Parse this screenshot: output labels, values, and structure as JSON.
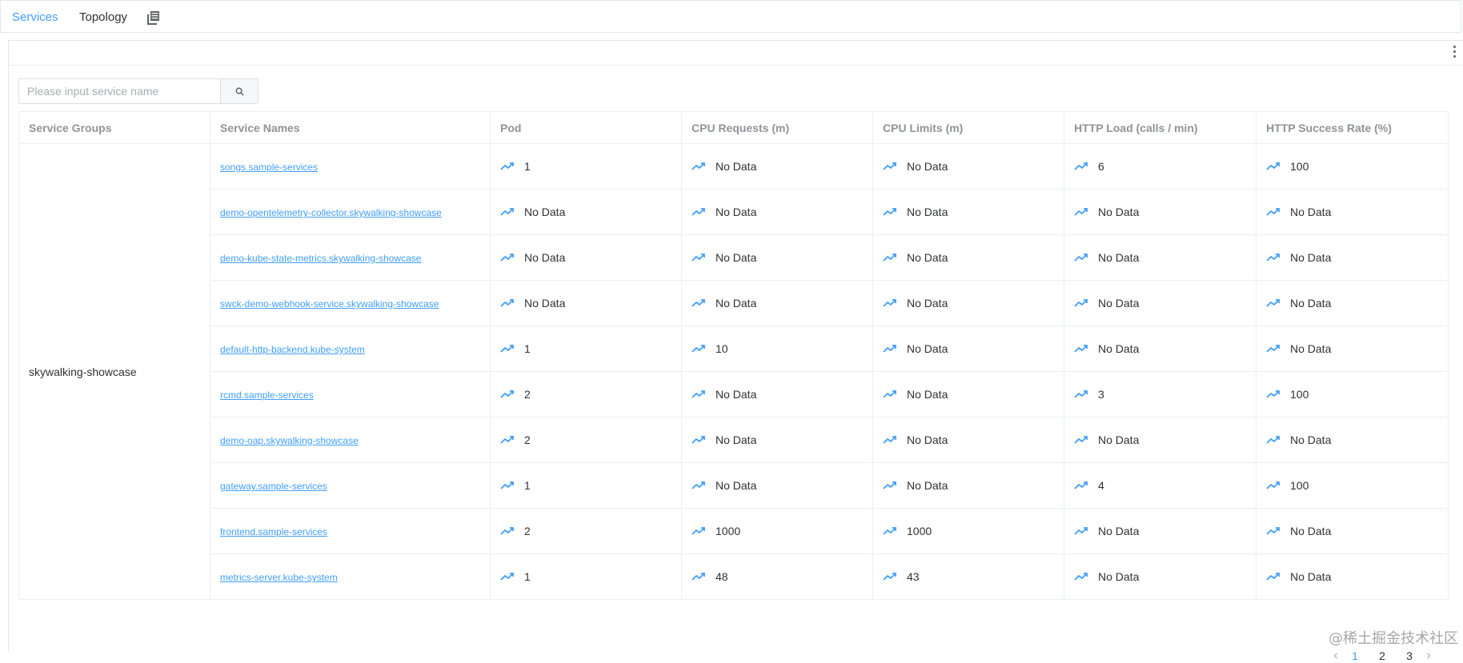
{
  "tabs": {
    "services": "Services",
    "topology": "Topology"
  },
  "search": {
    "placeholder": "Please input service name"
  },
  "table": {
    "headers": {
      "service_groups": "Service Groups",
      "service_names": "Service Names",
      "pod": "Pod",
      "cpu_requests": "CPU Requests (m)",
      "cpu_limits": "CPU Limits (m)",
      "http_load": "HTTP Load (calls / min)",
      "http_success": "HTTP Success Rate (%)"
    },
    "group": "skywalking-showcase",
    "rows": [
      {
        "name": "songs.sample-services",
        "pod": "1",
        "cpu_req": "No Data",
        "cpu_lim": "No Data",
        "load": "6",
        "success": "100"
      },
      {
        "name": "demo-opentelemetry-collector.skywalking-showcase",
        "pod": "No Data",
        "cpu_req": "No Data",
        "cpu_lim": "No Data",
        "load": "No Data",
        "success": "No Data"
      },
      {
        "name": "demo-kube-state-metrics.skywalking-showcase",
        "pod": "No Data",
        "cpu_req": "No Data",
        "cpu_lim": "No Data",
        "load": "No Data",
        "success": "No Data"
      },
      {
        "name": "swck-demo-webhook-service.skywalking-showcase",
        "pod": "No Data",
        "cpu_req": "No Data",
        "cpu_lim": "No Data",
        "load": "No Data",
        "success": "No Data"
      },
      {
        "name": "default-http-backend.kube-system",
        "pod": "1",
        "cpu_req": "10",
        "cpu_lim": "No Data",
        "load": "No Data",
        "success": "No Data"
      },
      {
        "name": "rcmd.sample-services",
        "pod": "2",
        "cpu_req": "No Data",
        "cpu_lim": "No Data",
        "load": "3",
        "success": "100"
      },
      {
        "name": "demo-oap.skywalking-showcase",
        "pod": "2",
        "cpu_req": "No Data",
        "cpu_lim": "No Data",
        "load": "No Data",
        "success": "No Data"
      },
      {
        "name": "gateway.sample-services",
        "pod": "1",
        "cpu_req": "No Data",
        "cpu_lim": "No Data",
        "load": "4",
        "success": "100"
      },
      {
        "name": "frontend.sample-services",
        "pod": "2",
        "cpu_req": "1000",
        "cpu_lim": "1000",
        "load": "No Data",
        "success": "No Data"
      },
      {
        "name": "metrics-server.kube-system",
        "pod": "1",
        "cpu_req": "48",
        "cpu_lim": "43",
        "load": "No Data",
        "success": "No Data"
      }
    ]
  },
  "pagination": {
    "pages": [
      "1",
      "2",
      "3"
    ],
    "current": "1",
    "prev": "‹",
    "next": "›"
  },
  "watermark": "@稀土掘金技术社区",
  "colors": {
    "accent": "#409eff",
    "header_text": "#909399",
    "border": "#ebeef5"
  },
  "icons": {
    "copy": "copy-icon",
    "search": "search-icon",
    "more": "more-vertical-icon",
    "trend": "trend-line-icon"
  }
}
